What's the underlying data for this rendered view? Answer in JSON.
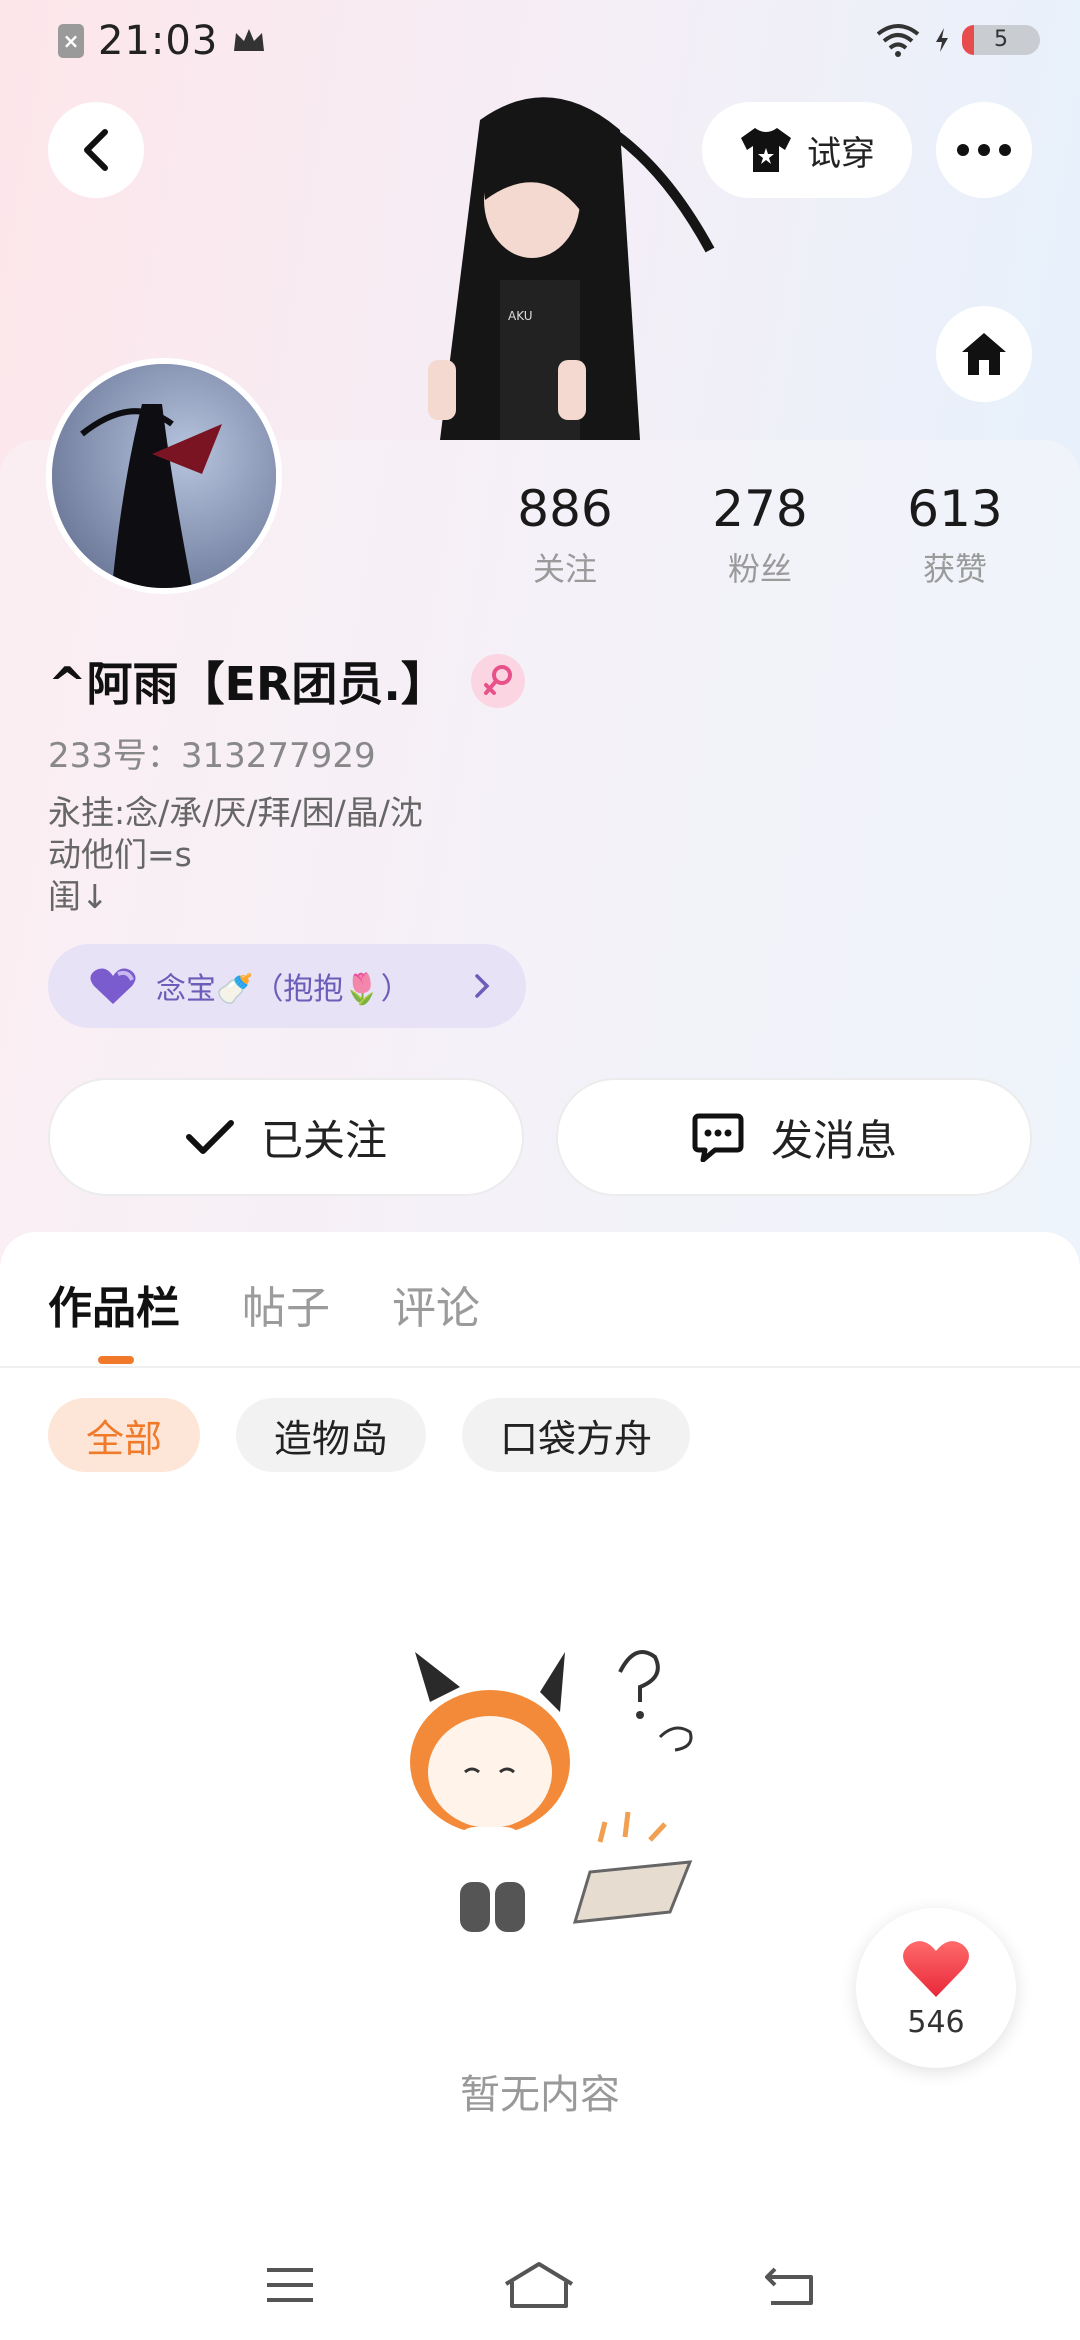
{
  "status_bar": {
    "time": "21:03",
    "battery_level": "5"
  },
  "header": {
    "tryon_label": "试穿"
  },
  "profile": {
    "stats": [
      {
        "value": "886",
        "label": "关注"
      },
      {
        "value": "278",
        "label": "粉丝"
      },
      {
        "value": "613",
        "label": "获赞"
      }
    ],
    "nickname": "^阿雨【ER团员.】",
    "uid": "233号：313277929",
    "bio_lines": [
      "永挂:念/承/厌/拜/困/晶/沈",
      "动他们=s",
      "闺↓"
    ],
    "fan_badge": "念宝🍼（抱抱🌷）",
    "follow_label": "已关注",
    "message_label": "发消息"
  },
  "content": {
    "tabs": [
      {
        "label": "作品栏"
      },
      {
        "label": "帖子"
      },
      {
        "label": "评论"
      }
    ],
    "chips": [
      {
        "label": "全部"
      },
      {
        "label": "造物岛"
      },
      {
        "label": "口袋方舟"
      }
    ],
    "empty_text": "暂无内容"
  },
  "like_fab": {
    "count": "546"
  },
  "colors": {
    "accent": "#f07a2a",
    "badge_bg": "#e7e2f6",
    "badge_text": "#6b5db8",
    "heart": "#f03a4a"
  },
  "icons": {
    "back": "chevron-left-icon",
    "more": "more-dots-icon",
    "home": "home-icon",
    "tryon": "tshirt-icon",
    "follow": "check-icon",
    "message": "chat-bubble-icon",
    "like": "heart-icon"
  }
}
